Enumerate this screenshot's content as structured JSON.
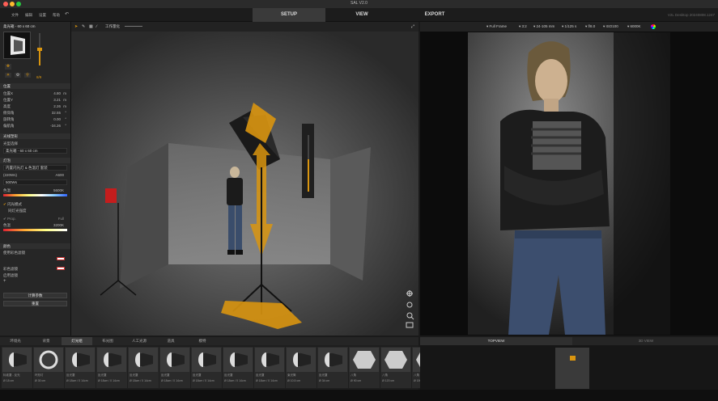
{
  "app": {
    "title": "SAL V2.0",
    "version_text": "V2L Desktop 20240808.1247"
  },
  "menu": [
    "文件",
    "编辑",
    "设置",
    "帮助"
  ],
  "modes": {
    "setup": "SETUP",
    "view": "VIEW",
    "export": "EXPORT"
  },
  "left_panel": {
    "object_title": "柔光箱 - 60 x 60 cm",
    "intensity": "8/9",
    "transform_header": "位置",
    "fields": [
      {
        "label": "位置X",
        "value": "4.80",
        "unit": "m"
      },
      {
        "label": "位置Y",
        "value": "3.21",
        "unit": "m"
      },
      {
        "label": "高度",
        "value": "2.26",
        "unit": "m"
      },
      {
        "label": "俯仰角",
        "value": "32.55",
        "unit": "°"
      },
      {
        "label": "旋转角",
        "value": "0.00",
        "unit": "°"
      },
      {
        "label": "偏航角",
        "value": "-34.26",
        "unit": "°"
      }
    ],
    "modifier_header": "光线塑形",
    "modifier_label": "光型选择",
    "modifier_value": "柔光箱 - 60 x 60 cm",
    "light_header": "灯泡",
    "light_type": "内置闪光灯 & 色温灯 套装",
    "power_label": "(220Ws)",
    "power_value": "A600",
    "mode_value": "500Ws",
    "ct_label": "色温",
    "ct_value": "5600K",
    "flash_label": "闪光模式",
    "flash_sub": "同灯光强度",
    "prop_label": "Prop.",
    "full_label": "Full",
    "ct2_label": "色温",
    "ct2_value": "3200K",
    "color_header": "颜色",
    "color_sub": "使用彩色滤镜",
    "gel_label": "彩色滤镜",
    "gel_sub": "启用滤镜",
    "btn_a": "计算参数",
    "btn_b": "重置"
  },
  "viewport": {
    "toolbar_label": "工作量化"
  },
  "camera_bar": {
    "frame": "Full Frame",
    "ratio": "3:2",
    "lens": "24-105 mm",
    "shutter": "1/125 s",
    "aperture": "f/8.0",
    "iso": "ISO100",
    "wb": "6000K"
  },
  "library": {
    "tabs": [
      "环境光",
      "背景",
      "灯光组",
      "布光图",
      "人工光源",
      "道具",
      "模特"
    ],
    "items": [
      {
        "name": "标准罩 - 反光",
        "size": "Ø 18 cm"
      },
      {
        "name": "环形灯",
        "size": "Ø 30 cm"
      },
      {
        "name": "反光罩",
        "size": "Ø 18cm / 0 14cm"
      },
      {
        "name": "反光罩",
        "size": "Ø 18cm / 0 14cm"
      },
      {
        "name": "反光罩",
        "size": "Ø 18cm / 0 14cm"
      },
      {
        "name": "反光罩",
        "size": "Ø 18cm / 0 14cm"
      },
      {
        "name": "反光罩",
        "size": "Ø 18cm / 0 14cm"
      },
      {
        "name": "反光罩",
        "size": "Ø 18cm / 0 14cm"
      },
      {
        "name": "反光罩",
        "size": "Ø 18cm / 0 14cm"
      },
      {
        "name": "束光筒",
        "size": "Ø 10.5 cm"
      },
      {
        "name": "反光罩",
        "size": "Ø 34 cm"
      },
      {
        "name": "八角",
        "size": "Ø 90 cm"
      },
      {
        "name": "八角",
        "size": "Ø 120 cm"
      },
      {
        "name": "八角",
        "size": "Ø 150 cm"
      }
    ]
  },
  "bottom_right": {
    "tab": "TOPVIEW",
    "tab2": "3D VIEW"
  },
  "colors": {
    "accent": "#d9950f",
    "red_light": "#c51d1d"
  }
}
